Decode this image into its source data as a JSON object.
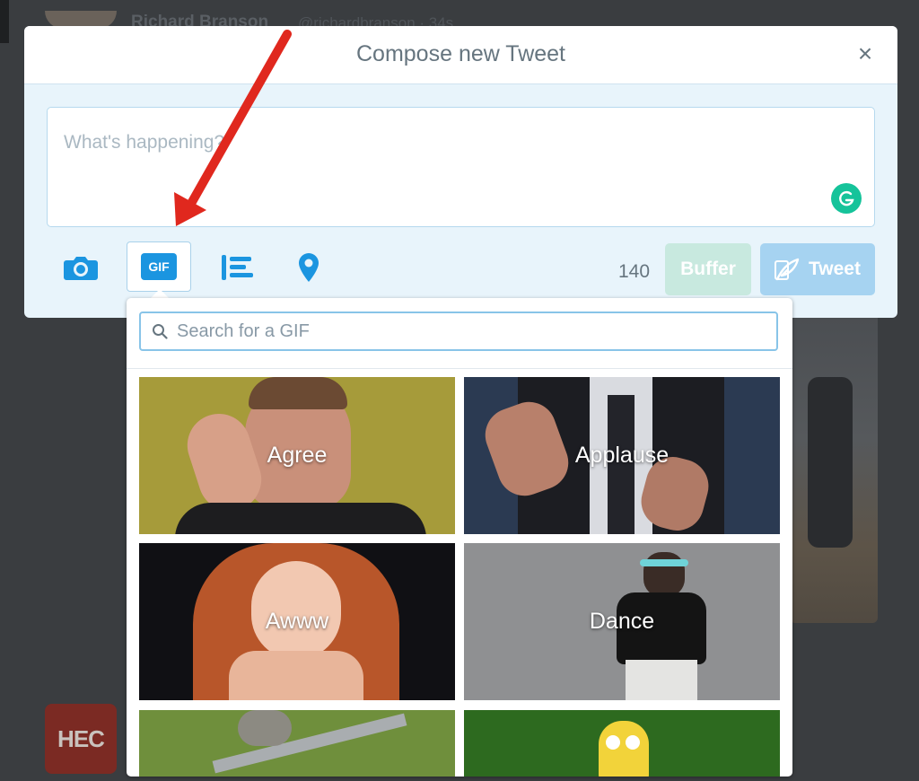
{
  "background": {
    "author_name": "Richard Branson",
    "author_handle": "@richardbranson · 34s",
    "logo_text": "HEC"
  },
  "modal": {
    "title": "Compose new Tweet",
    "close_label": "×",
    "composer_placeholder": "What's happening?",
    "char_count": "140",
    "buffer_label": "Buffer",
    "tweet_label": "Tweet",
    "gif_label": "GIF"
  },
  "gif_panel": {
    "search_placeholder": "Search for a GIF",
    "tiles": [
      {
        "label": "Agree"
      },
      {
        "label": "Applause"
      },
      {
        "label": "Awww"
      },
      {
        "label": "Dance"
      },
      {
        "label": ""
      },
      {
        "label": ""
      }
    ]
  },
  "colors": {
    "accent": "#1b95e0",
    "annotation_arrow": "#e0281e",
    "grammarly": "#15c39a"
  }
}
